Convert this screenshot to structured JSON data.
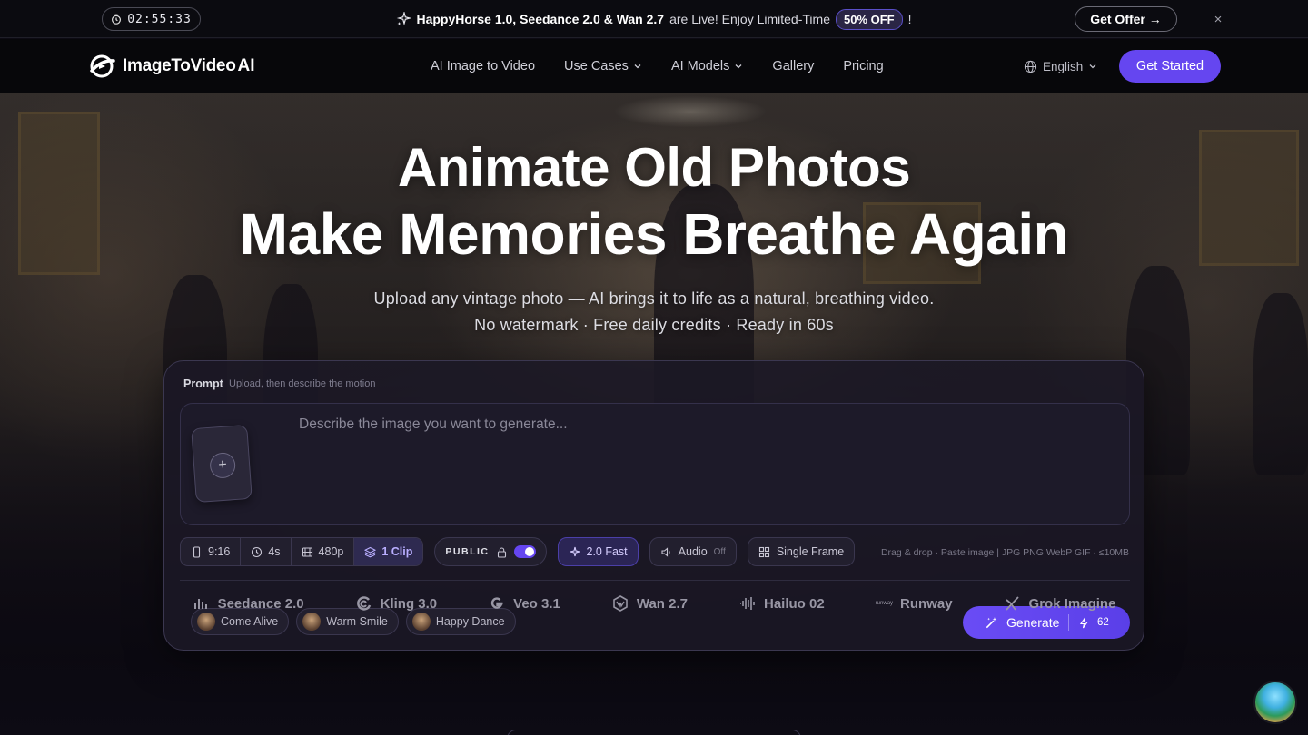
{
  "announcement": {
    "timer": "02:55:33",
    "models_text": "HappyHorse 1.0, Seedance 2.0 & Wan 2.7",
    "live_text": "are Live! Enjoy Limited-Time",
    "badge": "50% OFF",
    "exclaim": "!",
    "cta": "Get Offer →",
    "close": "×"
  },
  "nav": {
    "logo_text": "ImageToVideo",
    "logo_ai": "AI",
    "links": [
      "AI Image to Video",
      "Use Cases",
      "AI Models",
      "Gallery",
      "Pricing"
    ],
    "language": "English",
    "cta": "Get Started"
  },
  "hero": {
    "title_line1": "Animate Old Photos",
    "title_line2": "Make Memories Breathe Again",
    "subtitle_line1": "Upload any vintage photo — AI brings it to life as a natural, breathing video.",
    "subtitle_line2": "No watermark · Free daily credits · Ready in 60s"
  },
  "card": {
    "label": "Prompt",
    "hint": "Upload, then describe the motion",
    "placeholder": "Describe the image you want to generate...",
    "options": {
      "aspect": "9:16",
      "duration": "4s",
      "resolution": "480p",
      "clips": "1 Clip"
    },
    "visibility": "PUBLIC",
    "model": "2.0 Fast",
    "audio": "Audio",
    "audio_state": "Off",
    "frame_mode": "Single Frame",
    "file_hint": "Drag & drop · Paste image  |  JPG PNG WebP GIF · ≤10MB",
    "presets": [
      "Come Alive",
      "Warm Smile",
      "Happy Dance"
    ],
    "generate": "Generate",
    "credits": "62"
  },
  "models": {
    "seedance": "Seedance 2.0",
    "kling": "Kling 3.0",
    "veo": "Veo 3.1",
    "wan": "Wan 2.7",
    "hailuo": "Hailuo 02",
    "runway_small": "runway",
    "runway": "Runway",
    "grok": "Grok Imagine"
  },
  "colors": {
    "accent": "#6546f0",
    "background": "#0d0b14",
    "card": "#1b1826"
  }
}
